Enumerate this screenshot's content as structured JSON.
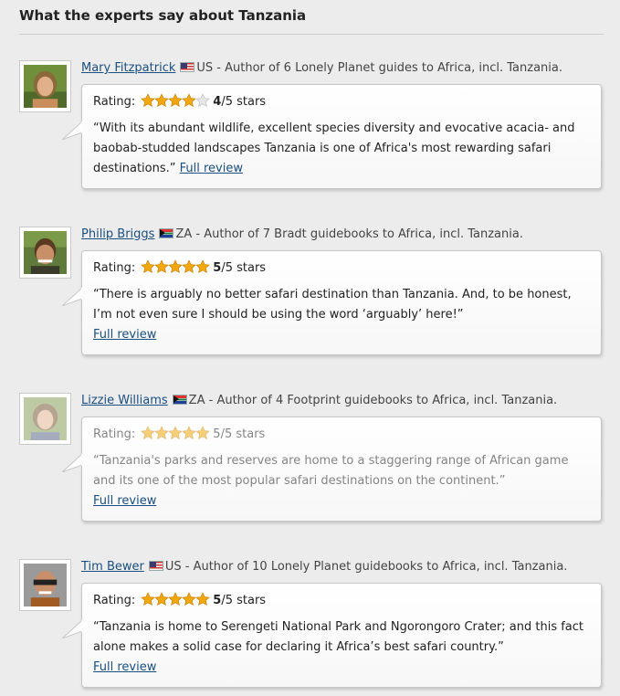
{
  "section": {
    "title": "What the experts say about Tanzania"
  },
  "experts": [
    {
      "name": "Mary Fitzpatrick",
      "country": "US",
      "flag": "us-flag-icon",
      "role": " - Author of 6 Lonely Planet guides to Africa, incl. Tanzania.",
      "rating_label": "Rating:",
      "rating": 4,
      "score_num": "4",
      "score_rest": "/5 stars",
      "quote": "“With its abundant wildlife, excellent species diversity and evocative acacia- and baobab-studded landscapes Tanzania is one of Africa's most rewarding safari destinations.”",
      "link": "Full review"
    },
    {
      "name": "Philip Briggs",
      "country": "ZA",
      "flag": "za-flag-icon",
      "role": " - Author of 7 Bradt guidebooks to Africa, incl. Tanzania.",
      "rating_label": "Rating:",
      "rating": 5,
      "score_num": "5",
      "score_rest": "/5 stars",
      "quote": "“There is arguably no better safari destination than Tanzania. And, to be honest, I’m not even sure I should be using the word ‘arguably’ here!”",
      "link": "Full review"
    },
    {
      "name": "Lizzie Williams",
      "country": "ZA",
      "flag": "za-flag-icon",
      "role": " - Author of 4 Footprint guidebooks to Africa, incl. Tanzania.",
      "rating_label": "Rating:",
      "rating": 5,
      "score_num": "5",
      "score_rest": "/5 stars",
      "quote": "“Tanzania's parks and reserves are home to a staggering range of African game and its one of the most popular safari destinations on the continent.”",
      "link": "Full review"
    },
    {
      "name": "Tim Bewer",
      "country": "US",
      "flag": "us-flag-icon",
      "role": " - Author of 10 Lonely Planet guidebooks to Africa, incl. Tanzania.",
      "rating_label": "Rating:",
      "rating": 5,
      "score_num": "5",
      "score_rest": "/5 stars",
      "quote": "“Tanzania is home to Serengeti National Park and Ngorongoro Crater; and this fact alone makes a solid case for declaring it Africa’s best safari country.”",
      "link": "Full review"
    }
  ],
  "colors": {
    "link": "#1a4f80",
    "star": "#f2a70c",
    "background": "#ececec"
  }
}
